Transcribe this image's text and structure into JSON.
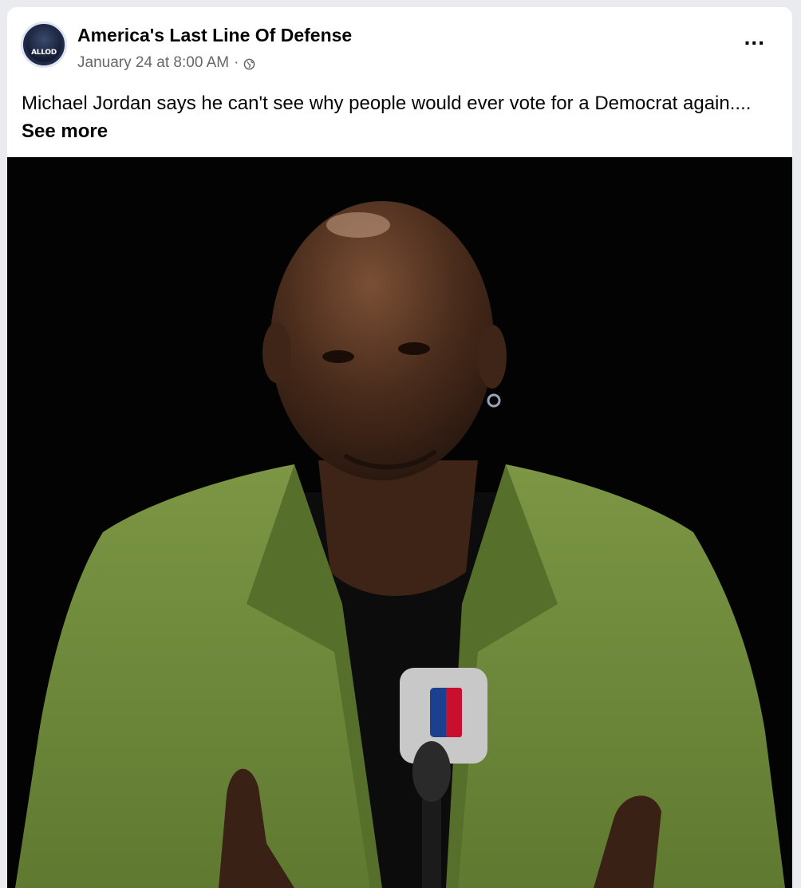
{
  "post": {
    "page_name": "America's Last Line Of Defense",
    "avatar_text": "ALLOD",
    "timestamp": "January 24 at 8:00 AM",
    "separator": "·",
    "audience_icon": "globe-icon",
    "more_icon": "more-options-icon",
    "more_label": "...",
    "caption_text": "Michael Jordan says he can't see why people would ever vote for a Democrat again....",
    "see_more_label": "See more"
  },
  "colors": {
    "background": "#e9ebee",
    "card": "#ffffff",
    "primary_text": "#050505",
    "secondary_text": "#65676b",
    "photo_background": "#030303",
    "jacket": "#6f8a3c"
  }
}
